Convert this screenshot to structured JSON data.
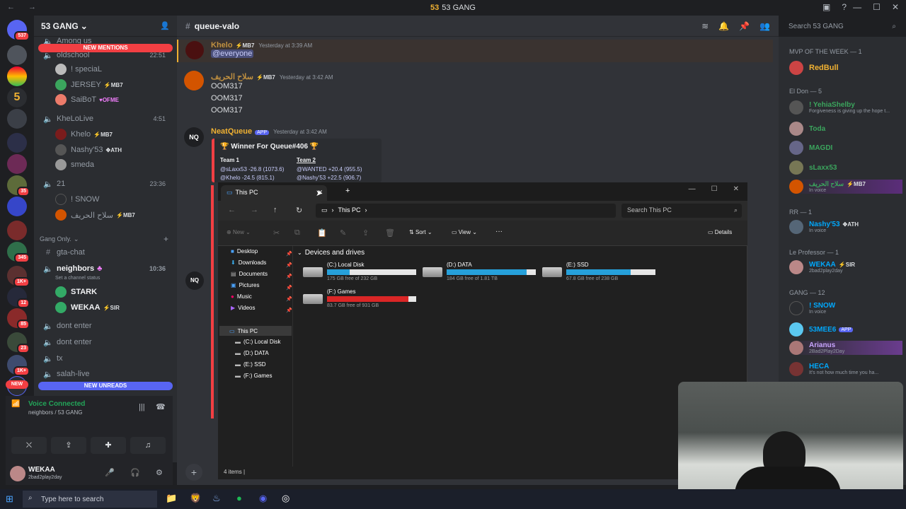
{
  "window": {
    "title": "53 GANG",
    "logo": "53",
    "nav": "← →"
  },
  "server": {
    "name": "53 GANG",
    "channel": "queue-valo"
  },
  "sidebar": {
    "channels_top": [
      {
        "name": "Among us",
        "y": 0
      },
      {
        "name": "oldschool",
        "time": "22:51"
      }
    ],
    "new_mentions": "NEW MENTIONS",
    "new_unreads": "NEW UNREADS",
    "oldschool_users": [
      "! speciaL",
      "JERSEY",
      "SaiBoT"
    ],
    "oldschool_tags": [
      "",
      "MB7",
      "OFME"
    ],
    "kheloLive": {
      "name": "KheLoLive",
      "time": "4:51",
      "users": [
        "Khelo",
        "Nashy'53",
        "smeda"
      ],
      "tags": [
        "MB7",
        "ATH",
        ""
      ]
    },
    "ch21": {
      "name": "21",
      "time": "23:36",
      "users": [
        "! SNOW",
        "سلاح الحريف"
      ],
      "tags": [
        "",
        "MB7"
      ]
    },
    "category": "Gang Only.",
    "text_channels": [
      "gta-chat"
    ],
    "neighbors": {
      "name": "neighbors",
      "time": "10:36",
      "status": "Set a channel status",
      "users": [
        "STARK",
        "WEKAA"
      ],
      "tags": [
        "",
        "SIR"
      ]
    },
    "more_channels": [
      "dont enter",
      "dont enter",
      "tx",
      "salah-live"
    ]
  },
  "voice": {
    "status": "Voice Connected",
    "location": "neighbors / 53 GANG"
  },
  "user": {
    "name": "WEKAA",
    "status": "2bad2play2day"
  },
  "messages": [
    {
      "user": "Khelo",
      "tag": "MB7",
      "ts": "Yesterday at 3:39 AM",
      "text": [
        "@everyone"
      ],
      "color": "#f0b132"
    },
    {
      "user": "سلاح الحريف",
      "tag": "MB7",
      "ts": "Yesterday at 3:42 AM",
      "text": [
        "OOM317",
        "OOM317",
        "OOM317"
      ],
      "color": "#f0b132"
    },
    {
      "user": "NeatQueue",
      "tag": "APP",
      "ts": "Yesterday at 3:42 AM",
      "color": "#f0b132"
    }
  ],
  "embed": {
    "title": "🏆 Winner For Queue#406 🏆",
    "team1": "Team 1",
    "team2": "Team 2",
    "t1": [
      "@sLaxx53  -26.8 (1073.6)",
      "@Khelo  -24.5 (815.1)"
    ],
    "t2": [
      "@WANTED  +20.4 (955.5)",
      "@Nashy'53  +22.5 (906.7)"
    ]
  },
  "members": {
    "search_placeholder": "Search 53 GANG",
    "groups": [
      {
        "header": "MVP OF THE WEEK — 1",
        "members": [
          {
            "name": "RedBull",
            "color": "#f0b132",
            "sub": ""
          }
        ]
      },
      {
        "header": "El Don — 5",
        "members": [
          {
            "name": "! YehiaShelby",
            "color": "#3ba55d",
            "sub": "Forgiveness is giving up the hope t..."
          },
          {
            "name": "Toda",
            "color": "#3ba55d",
            "sub": ""
          },
          {
            "name": "MAGDI",
            "color": "#3ba55d",
            "sub": ""
          },
          {
            "name": "sLaxx53",
            "color": "#3ba55d",
            "sub": ""
          },
          {
            "name": "سلاح الحريف",
            "color": "#3ba55d",
            "sub": "In voice",
            "tag": "MB7"
          }
        ]
      },
      {
        "header": "RR — 1",
        "members": [
          {
            "name": "Nashy'53",
            "color": "#00a8fc",
            "sub": "In voice",
            "tag": "ATH"
          }
        ]
      },
      {
        "header": "Le Professor — 1",
        "members": [
          {
            "name": "WEKAA",
            "color": "#00a8fc",
            "sub": "2bad2play2day",
            "tag": "SIR"
          }
        ]
      },
      {
        "header": "GANG — 12",
        "members": [
          {
            "name": "! SNOW",
            "color": "#00a8fc",
            "sub": "In voice"
          },
          {
            "name": "53MEE6",
            "color": "#00a8fc",
            "sub": "",
            "tag": "APP"
          },
          {
            "name": "Arianus",
            "color": "#c9a5ff",
            "sub": "2Bad2Play2Day"
          },
          {
            "name": "HECA",
            "color": "#00a8fc",
            "sub": "It's not how much time you ha..."
          }
        ]
      }
    ]
  },
  "explorer": {
    "tab": "This PC",
    "address": "This PC",
    "search": "Search This PC",
    "new_label": "New",
    "sort_label": "Sort",
    "view_label": "View",
    "details_label": "Details",
    "section": "Devices and drives",
    "quick": [
      "Desktop",
      "Downloads",
      "Documents",
      "Pictures",
      "Music",
      "Videos"
    ],
    "tree_root": "This PC",
    "tree": [
      "(C:) Local Disk",
      "(D:) DATA",
      "(E:) SSD",
      "(F:) Games"
    ],
    "drives": [
      {
        "name": "(C:) Local Disk",
        "free": "175 GB free of 232 GB",
        "used": 0.25,
        "color": "#26a0da"
      },
      {
        "name": "(D:) DATA",
        "free": "184 GB free of 1.81 TB",
        "used": 0.9,
        "color": "#26a0da"
      },
      {
        "name": "(E:) SSD",
        "free": "67.8 GB free of 238 GB",
        "used": 0.72,
        "color": "#26a0da"
      },
      {
        "name": "(F:) Games",
        "free": "83.7 GB free of 931 GB",
        "used": 0.91,
        "color": "#da2626"
      }
    ],
    "status": "4 items"
  },
  "taskbar": {
    "search": "Type here to search"
  }
}
